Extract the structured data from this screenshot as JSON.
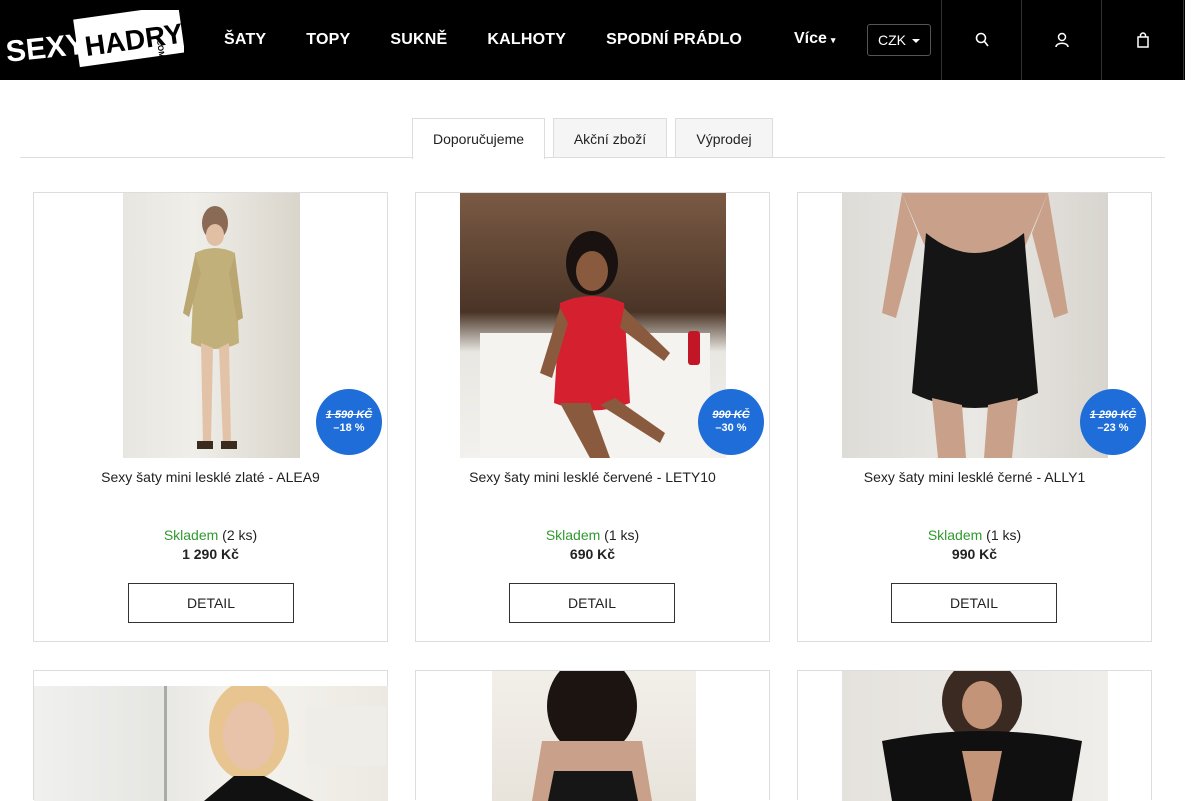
{
  "header": {
    "logo_text": "SEXYHADRY.com",
    "nav": [
      "ŠATY",
      "TOPY",
      "SUKNĚ",
      "KALHOTY",
      "SPODNÍ PRÁDLO"
    ],
    "more_label": "Více",
    "currency": "CZK",
    "icons": [
      "search-icon",
      "user-icon",
      "cart-icon"
    ]
  },
  "tabs": [
    {
      "label": "Doporučujeme",
      "active": true
    },
    {
      "label": "Akční zboží",
      "active": false
    },
    {
      "label": "Výprodej",
      "active": false
    }
  ],
  "products": [
    {
      "name": "Sexy šaty mini lesklé zlaté - ALEA9",
      "stock_label": "Skladem",
      "stock_qty": "(2 ks)",
      "price": "1 290 Kč",
      "detail": "DETAIL",
      "badge_old": "1 590 KČ",
      "badge_discount": "–18 %",
      "image_colors": [
        "#c9b98a",
        "#e6e3dc"
      ]
    },
    {
      "name": "Sexy šaty mini lesklé červené - LETY10",
      "stock_label": "Skladem",
      "stock_qty": "(1 ks)",
      "price": "690 Kč",
      "detail": "DETAIL",
      "badge_old": "990 KČ",
      "badge_discount": "–30 %",
      "image_colors": [
        "#5a3a2a",
        "#d42030"
      ]
    },
    {
      "name": "Sexy šaty mini lesklé černé - ALLY1",
      "stock_label": "Skladem",
      "stock_qty": "(1 ks)",
      "price": "990 Kč",
      "detail": "DETAIL",
      "badge_old": "1 290 KČ",
      "badge_discount": "–23 %",
      "image_colors": [
        "#c8a894",
        "#111"
      ]
    }
  ],
  "colors": {
    "accent": "#1f6dd8",
    "stock_green": "#2f9a2f",
    "header_bg": "#000000"
  }
}
